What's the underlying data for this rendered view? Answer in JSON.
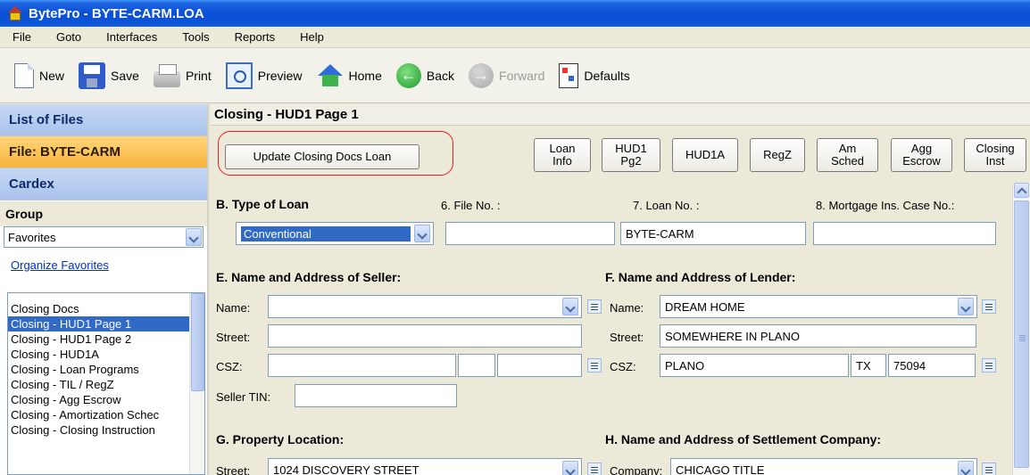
{
  "window": {
    "title": "BytePro - BYTE-CARM.LOA"
  },
  "menu": [
    "File",
    "Goto",
    "Interfaces",
    "Tools",
    "Reports",
    "Help"
  ],
  "toolbar": {
    "new": "New",
    "save": "Save",
    "print": "Print",
    "preview": "Preview",
    "home": "Home",
    "back": "Back",
    "forward": "Forward",
    "defaults": "Defaults"
  },
  "sidebar": {
    "list_of_files": "List of Files",
    "file": "File: BYTE-CARM",
    "cardex": "Cardex",
    "group_label": "Group",
    "group_value": "Favorites",
    "organize_link": "Organize Favorites",
    "items": [
      "Closing Docs",
      "Closing - HUD1 Page 1",
      "Closing - HUD1 Page 2",
      "Closing - HUD1A",
      "Closing - Loan Programs",
      "Closing - TIL / RegZ",
      "Closing - Agg Escrow",
      "Closing - Amortization Schec",
      "Closing - Closing Instruction"
    ],
    "selected_index": 1
  },
  "main": {
    "title": "Closing - HUD1 Page 1",
    "update_button": "Update Closing Docs Loan",
    "nav_buttons": [
      [
        "Loan",
        "Info"
      ],
      [
        "HUD1",
        "Pg2"
      ],
      [
        "HUD1A"
      ],
      [
        "RegZ"
      ],
      [
        "Am",
        "Sched"
      ],
      [
        "Agg",
        "Escrow"
      ],
      [
        "Closing",
        "Inst"
      ]
    ]
  },
  "form": {
    "type_of_loan_label": "B. Type of Loan",
    "file_no_label": "6. File No. :",
    "loan_no_label": "7. Loan No. :",
    "mortgage_case_label": "8. Mortgage Ins. Case No.:",
    "loan_type_value": "Conventional",
    "file_no_value": "",
    "loan_no_value": "BYTE-CARM",
    "mortgage_case_value": "",
    "seller_header": "E. Name and Address of Seller:",
    "lender_header": "F. Name and Address of Lender:",
    "name_label": "Name:",
    "street_label": "Street:",
    "csz_label": "CSZ:",
    "seller_tin_label": "Seller TIN:",
    "lender_name": "DREAM HOME",
    "lender_street": "SOMEWHERE IN PLANO",
    "lender_city": "PLANO",
    "lender_state": "TX",
    "lender_zip": "75094",
    "property_header": "G. Property Location:",
    "settlement_header": "H. Name and Address of Settlement Company:",
    "property_street": "1024 DISCOVERY STREET",
    "company_label": "Company:",
    "company_value": "CHICAGO TITLE"
  }
}
